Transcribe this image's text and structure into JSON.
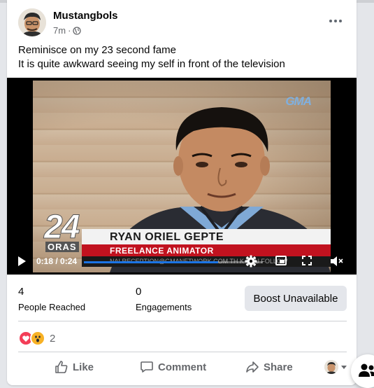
{
  "post": {
    "author": "Mustangbols",
    "time": "7m",
    "separator": "·",
    "privacy_icon": "globe-icon",
    "lines": [
      "Reminisce on my 23 second fame",
      "It is quite awkward seeing my self in front of the television"
    ]
  },
  "video": {
    "broadcaster": "GMA",
    "show_number": "24",
    "show_word": "ORAS",
    "lower_third_name": "RYAN ORIEL GEPTE",
    "lower_third_role": "FREELANCE ANIMATOR",
    "lower_third_ticker": "NALRECEPTION@GMANETWORK.COM   TH   K YOU   FOLLOW",
    "time_display": "0:18 / 0:24",
    "progress_fraction": 0.75,
    "icons": [
      "play-icon",
      "settings-gear-icon",
      "picture-in-picture-icon",
      "fullscreen-icon",
      "volume-icon"
    ]
  },
  "insights": {
    "people_reached_value": "4",
    "people_reached_label": "People Reached",
    "engagements_value": "0",
    "engagements_label": "Engagements",
    "boost_label": "Boost Unavailable"
  },
  "reactions": {
    "icons": [
      "love-icon",
      "wow-icon"
    ],
    "count": "2"
  },
  "actions": {
    "like": "Like",
    "comment": "Comment",
    "share": "Share"
  },
  "colors": {
    "accent": "#1b74e4",
    "love": "#f33e58",
    "wow": "#f7b125",
    "lower_third_red": "#c1121f"
  }
}
